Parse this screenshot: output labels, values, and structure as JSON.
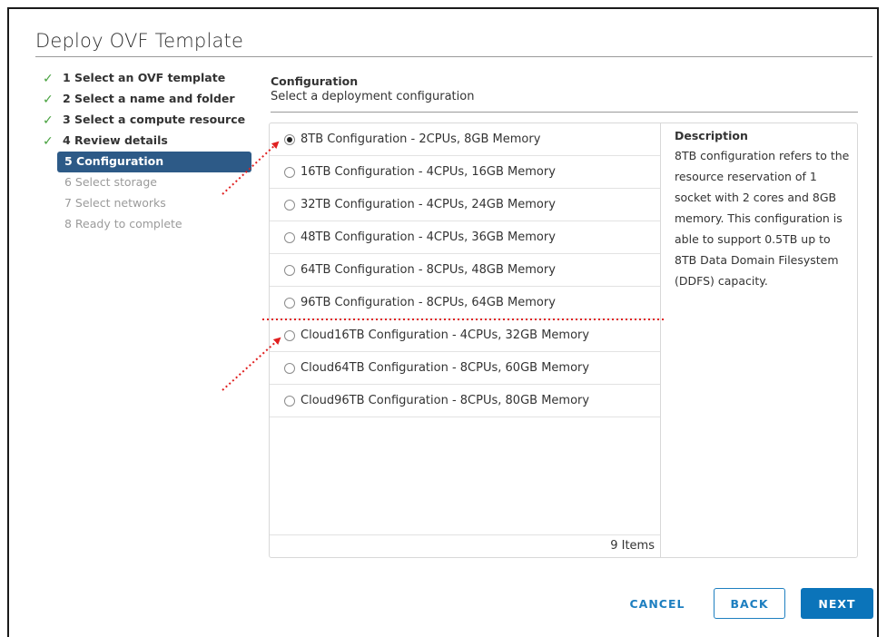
{
  "dialog": {
    "title": "Deploy OVF Template"
  },
  "steps": [
    {
      "label": "1 Select an OVF template",
      "state": "done"
    },
    {
      "label": "2 Select a name and folder",
      "state": "done"
    },
    {
      "label": "3 Select a compute resource",
      "state": "done"
    },
    {
      "label": "4 Review details",
      "state": "done"
    },
    {
      "label": "5 Configuration",
      "state": "active"
    },
    {
      "label": "6 Select storage",
      "state": "disabled"
    },
    {
      "label": "7 Select networks",
      "state": "disabled"
    },
    {
      "label": "8 Ready to complete",
      "state": "disabled"
    }
  ],
  "check_glyph": "✓",
  "section": {
    "title": "Configuration",
    "subtitle": "Select a deployment configuration"
  },
  "configurations": [
    {
      "label": "8TB Configuration - 2CPUs, 8GB Memory",
      "selected": true
    },
    {
      "label": "16TB Configuration - 4CPUs, 16GB Memory",
      "selected": false
    },
    {
      "label": "32TB Configuration - 4CPUs, 24GB Memory",
      "selected": false
    },
    {
      "label": "48TB Configuration - 4CPUs, 36GB Memory",
      "selected": false
    },
    {
      "label": "64TB Configuration - 8CPUs, 48GB Memory",
      "selected": false
    },
    {
      "label": "96TB Configuration - 8CPUs, 64GB Memory",
      "selected": false
    },
    {
      "label": "Cloud16TB Configuration - 4CPUs, 32GB Memory",
      "selected": false
    },
    {
      "label": "Cloud64TB Configuration - 8CPUs, 60GB Memory",
      "selected": false
    },
    {
      "label": "Cloud96TB Configuration - 8CPUs, 80GB Memory",
      "selected": false
    }
  ],
  "list_footer": "9 Items",
  "description": {
    "title": "Description",
    "text": "8TB configuration refers to the resource reservation of 1 socket with 2 cores and 8GB memory. This configuration is able to support 0.5TB up to 8TB Data Domain Filesystem (DDFS) capacity."
  },
  "buttons": {
    "cancel": "CANCEL",
    "back": "BACK",
    "next": "NEXT"
  },
  "colors": {
    "accent": "#0b74ba",
    "active_step": "#2d5a87",
    "check": "#48a23f",
    "annotation": "#e02020"
  }
}
